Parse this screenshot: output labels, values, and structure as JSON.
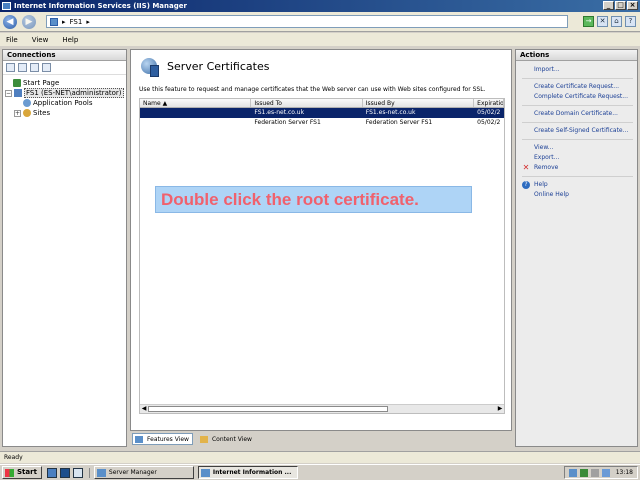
{
  "window": {
    "title": "Internet Information Services (IIS) Manager"
  },
  "address": {
    "path_sep1": "▸",
    "node": "FS1",
    "path_sep2": "▸"
  },
  "menu": {
    "items": [
      "File",
      "View",
      "Help"
    ]
  },
  "connections": {
    "header": "Connections",
    "tree": [
      {
        "label": "Start Page",
        "icon": "start-page-icon"
      },
      {
        "label": "FS1 (ES-NET\\administrator)",
        "icon": "server-icon"
      },
      {
        "label": "Application Pools",
        "icon": "app-pools-icon"
      },
      {
        "label": "Sites",
        "icon": "sites-icon"
      }
    ]
  },
  "center": {
    "title": "Server Certificates",
    "description": "Use this feature to request and manage certificates that the Web server can use with Web sites configured for SSL.",
    "columns": [
      "Name",
      "Issued To",
      "Issued By",
      "Expiratio"
    ],
    "rows": [
      {
        "name": "",
        "issued_to": "FS1.es-net.co.uk",
        "issued_by": "FS1.es-net.co.uk",
        "expiration": "05/02/2",
        "selected": true
      },
      {
        "name": "",
        "issued_to": "Federation Server FS1",
        "issued_by": "Federation Server FS1",
        "expiration": "05/02/2",
        "selected": false
      }
    ],
    "instruction": "Double click the root certificate."
  },
  "view_tabs": {
    "features": "Features View",
    "content": "Content View"
  },
  "actions": {
    "header": "Actions",
    "import": "Import...",
    "create_request": "Create Certificate Request...",
    "complete_request": "Complete Certificate Request...",
    "create_domain": "Create Domain Certificate...",
    "create_self_signed": "Create Self-Signed Certificate...",
    "view": "View...",
    "export": "Export...",
    "remove": "Remove",
    "help": "Help",
    "online_help": "Online Help"
  },
  "status": {
    "text": "Ready"
  },
  "taskbar": {
    "start": "Start",
    "tasks": [
      "Server Manager",
      "Internet Information ..."
    ],
    "clock": "13:18"
  }
}
